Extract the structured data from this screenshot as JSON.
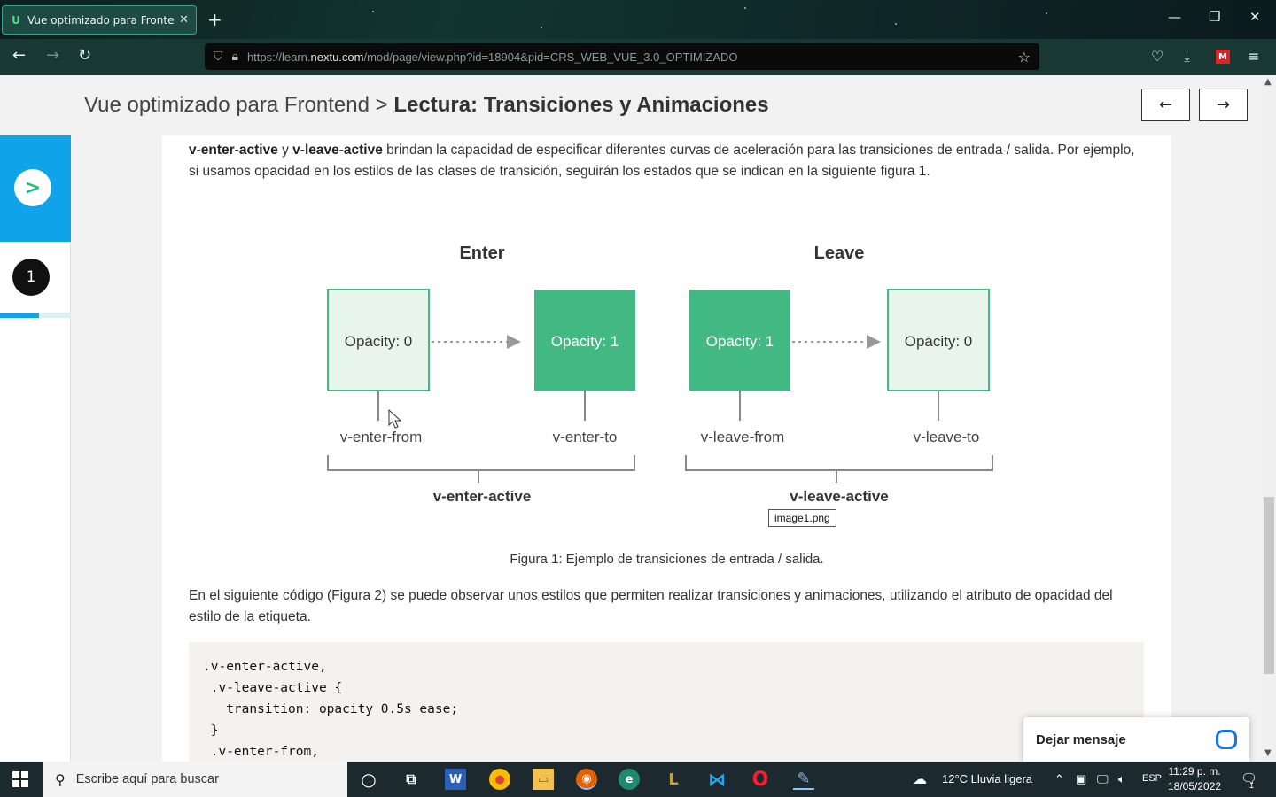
{
  "browser": {
    "tab_title": "Vue optimizado para Frontend",
    "tab_favicon": "U",
    "url_prefix": "https://learn.",
    "url_domain": "nextu.com",
    "url_path": "/mod/page/view.php?id=18904&pid=CRS_WEB_VUE_3.0_OPTIMIZADO"
  },
  "header": {
    "course": "Vue optimizado para Frontend",
    "separator": ">",
    "lesson": "Lectura: Transiciones y Animaciones",
    "prev_label": "←",
    "next_label": "→"
  },
  "sidebar": {
    "next_label": ">",
    "step_number": "1",
    "progress": 0.55
  },
  "content": {
    "intro_strong1": "v-enter-active",
    "intro_y": " y ",
    "intro_strong2": "v-leave-active",
    "intro_rest": " brindan la capacidad de especificar diferentes curvas de aceleración para las transiciones de entrada / salida. Por ejemplo, si usamos opacidad en los estilos de las clases de transición, seguirán los estados que se indican en la siguiente figura 1.",
    "figure": {
      "enter_title": "Enter",
      "leave_title": "Leave",
      "box1": "Opacity: 0",
      "box2": "Opacity: 1",
      "box3": "Opacity: 1",
      "box4": "Opacity: 0",
      "lbl1": "v-enter-from",
      "lbl2": "v-enter-to",
      "lbl3": "v-leave-from",
      "lbl4": "v-leave-to",
      "active1": "v-enter-active",
      "active2": "v-leave-active",
      "tooltip": "image1.png",
      "colors": {
        "green": "#42b883",
        "light": "#e8f5ec"
      }
    },
    "caption": "Figura 1: Ejemplo de transiciones de entrada / salida.",
    "para2": "En el siguiente código (Figura 2) se puede observar unos estilos que permiten realizar transiciones y animaciones, utilizando el atributo de opacidad del estilo de la etiqueta.",
    "code": [
      ".v-enter-active,",
      " .v-leave-active {",
      "   transition: opacity 0.5s ease;",
      " }",
      " .v-enter-from,"
    ]
  },
  "chat": {
    "label": "Dejar mensaje"
  },
  "taskbar": {
    "search_placeholder": "Escribe aquí para buscar",
    "weather": "12°C  Lluvia ligera",
    "lang": "ESP",
    "time": "11:29 p. m.",
    "date": "18/05/2022",
    "notif_count": "1"
  }
}
